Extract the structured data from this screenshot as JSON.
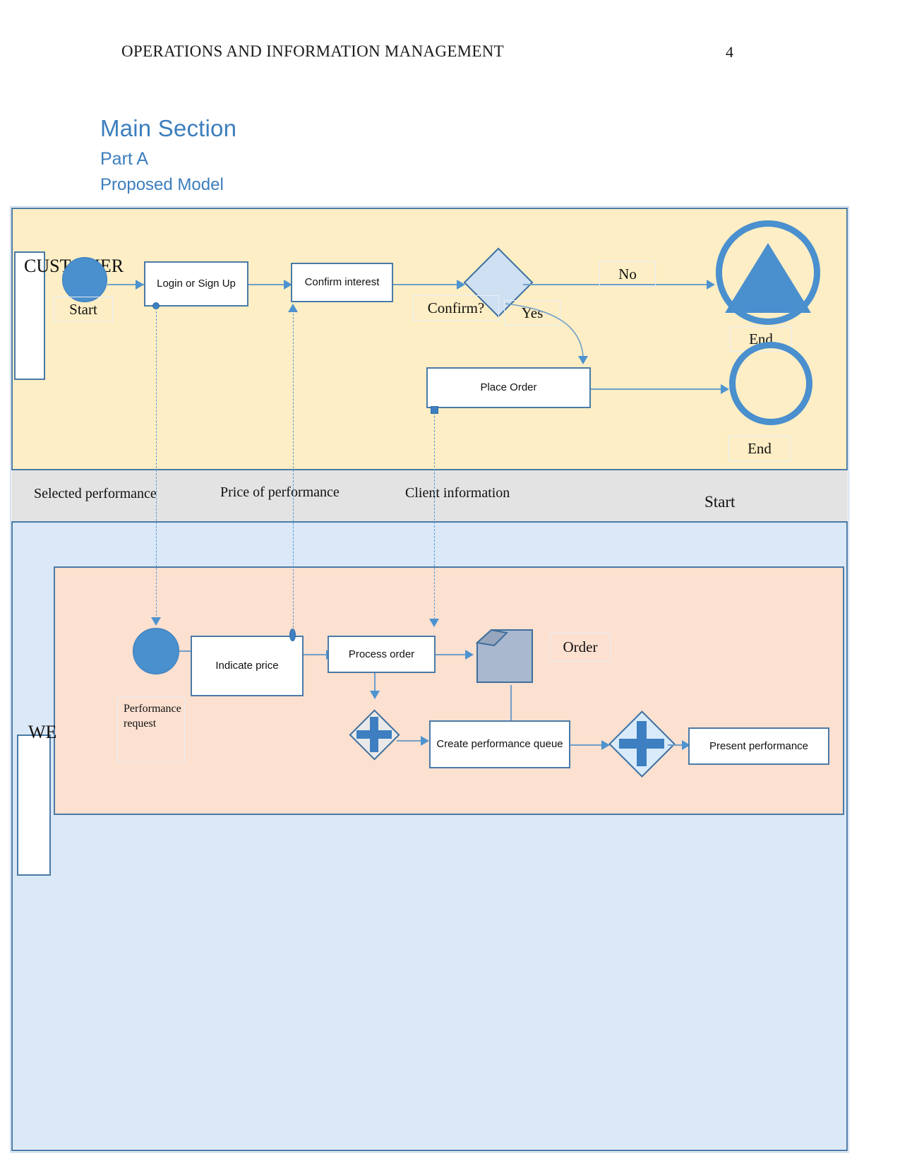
{
  "header": {
    "title": "OPERATIONS AND INFORMATION MANAGEMENT",
    "page_number": "4"
  },
  "headings": {
    "main": "Main Section",
    "part": "Part A",
    "subtitle": "Proposed Model"
  },
  "colors": {
    "heading": "#3c7ebd",
    "customer_lane": "#fdeec5",
    "website_lane": "#dbe8f7",
    "subprocess": "#fce0d0",
    "middle_band": "#e3e3e3",
    "lane_border": "#4a7aa7",
    "event_blue": "#4a8fce",
    "connector": "#6f9fc8"
  },
  "diagram": {
    "lanes": {
      "customer": {
        "title": "CUSTOMER"
      },
      "website": {
        "title": "WE"
      }
    },
    "customer_lane": {
      "start_event_label": "Start",
      "tasks": [
        {
          "id": "login",
          "label": "Login or Sign Up"
        },
        {
          "id": "confirm_interest",
          "label": "Confirm interest"
        },
        {
          "id": "place_order",
          "label": "Place Order"
        }
      ],
      "gateway": {
        "label": "Confirm?"
      },
      "flow_labels": {
        "no": "No",
        "yes": "Yes"
      },
      "end_events": [
        {
          "id": "end_terminate",
          "label": "End"
        },
        {
          "id": "end_plain",
          "label": "End"
        }
      ]
    },
    "middle_band": {
      "labels": [
        "Selected performance",
        "Price of performance",
        "Client information",
        "Start"
      ]
    },
    "website_lane": {
      "start_event_label": "",
      "annotation": "Performance request",
      "tasks": [
        {
          "id": "indicate_price",
          "label": "Indicate price"
        },
        {
          "id": "process_order",
          "label": "Process order"
        },
        {
          "id": "create_queue",
          "label": "Create performance queue"
        },
        {
          "id": "present_performance",
          "label": "Present performance"
        }
      ],
      "artifact": {
        "id": "order_doc",
        "label": "Order"
      },
      "gateways": [
        {
          "id": "parallel_gw_1",
          "type": "parallel"
        },
        {
          "id": "parallel_gw_2",
          "type": "parallel"
        }
      ]
    },
    "message_flows": [
      {
        "from": "login",
        "to": "website_start",
        "label": "Selected performance"
      },
      {
        "from": "indicate_price",
        "to": "confirm_interest",
        "label": "Price of performance"
      },
      {
        "from": "place_order",
        "to": "process_order",
        "label": "Client information"
      }
    ]
  }
}
